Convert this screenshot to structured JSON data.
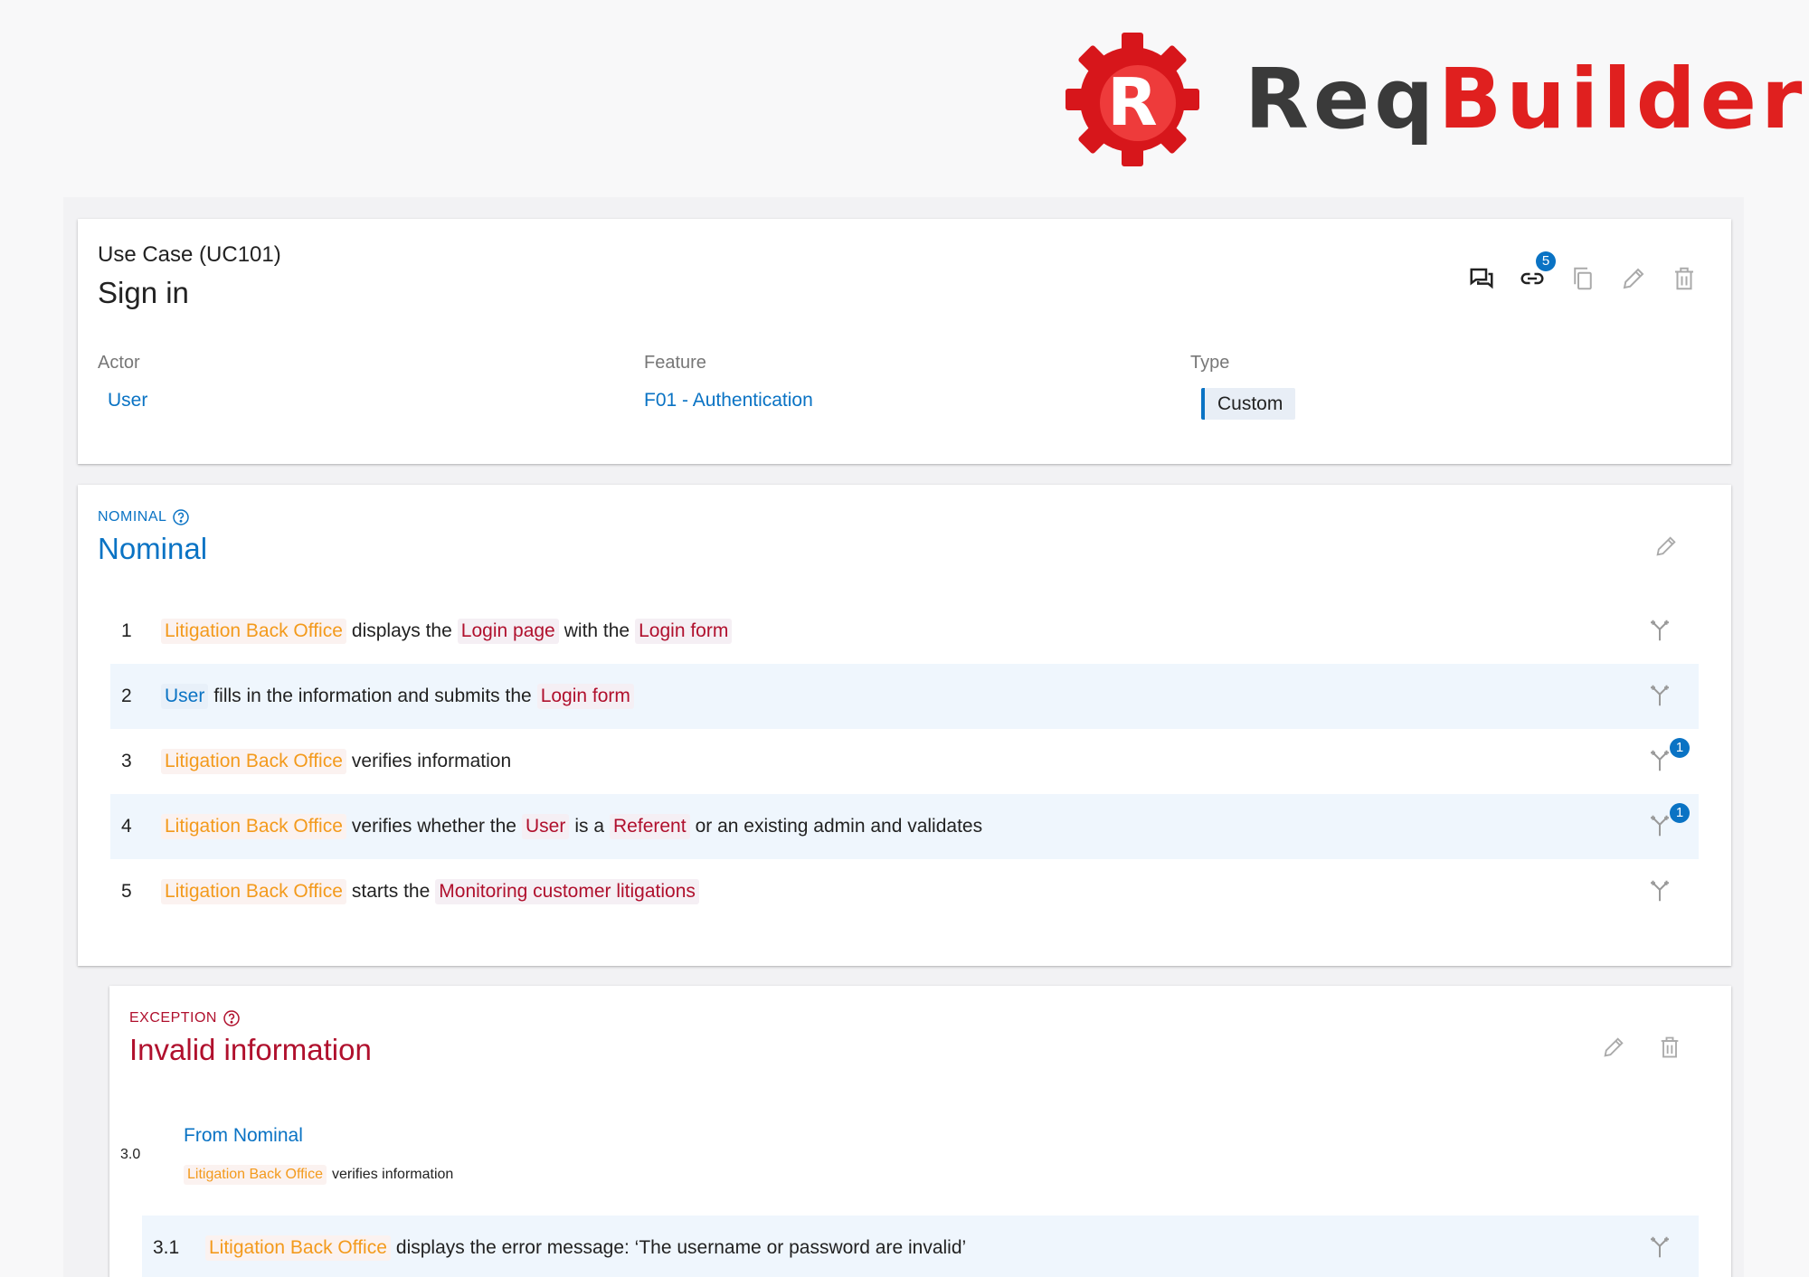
{
  "brand": {
    "logo_letter": "R",
    "name_part1": "Req",
    "name_part2": "Builder",
    "primary_color": "#e0201f"
  },
  "use_case": {
    "kind_label": "Use Case (UC101)",
    "title": "Sign in",
    "toolbar": {
      "comments_icon": "comments-icon",
      "links_icon": "link-icon",
      "links_count": "5",
      "copy_icon": "copy-icon",
      "edit_icon": "pencil-icon",
      "delete_icon": "trash-icon"
    },
    "fields": {
      "actor_label": "Actor",
      "actor_value": "User",
      "feature_label": "Feature",
      "feature_value": "F01 - Authentication",
      "type_label": "Type",
      "type_value": "Custom"
    }
  },
  "nominal": {
    "kind_label": "NOMINAL",
    "title": "Nominal",
    "accent_color": "#0a73c4",
    "steps": [
      {
        "num": "1",
        "parts": [
          "Litigation Back Office",
          "displays the",
          "Login page",
          "with the",
          "Login form"
        ]
      },
      {
        "num": "2",
        "parts": [
          "User",
          "fills in the information and submits the",
          "Login form"
        ]
      },
      {
        "num": "3",
        "parts": [
          "Litigation Back Office",
          "verifies information"
        ],
        "branch_count": "1"
      },
      {
        "num": "4",
        "parts": [
          "Litigation Back Office",
          "verifies whether the",
          "User",
          "is a",
          "Referent",
          "or an existing admin and validates"
        ],
        "branch_count": "1"
      },
      {
        "num": "5",
        "parts": [
          "Litigation Back Office",
          "starts the",
          "Monitoring customer litigations"
        ]
      }
    ]
  },
  "exception": {
    "kind_label": "EXCEPTION",
    "title": "Invalid information",
    "accent_color": "#b0102d",
    "from_label": "From Nominal",
    "origin_step": {
      "num": "3.0",
      "parts": [
        "Litigation Back Office",
        "verifies information"
      ]
    },
    "steps": [
      {
        "num": "3.1",
        "parts": [
          "Litigation Back Office",
          "displays the error message: ‘The username or password are invalid’"
        ]
      }
    ]
  }
}
